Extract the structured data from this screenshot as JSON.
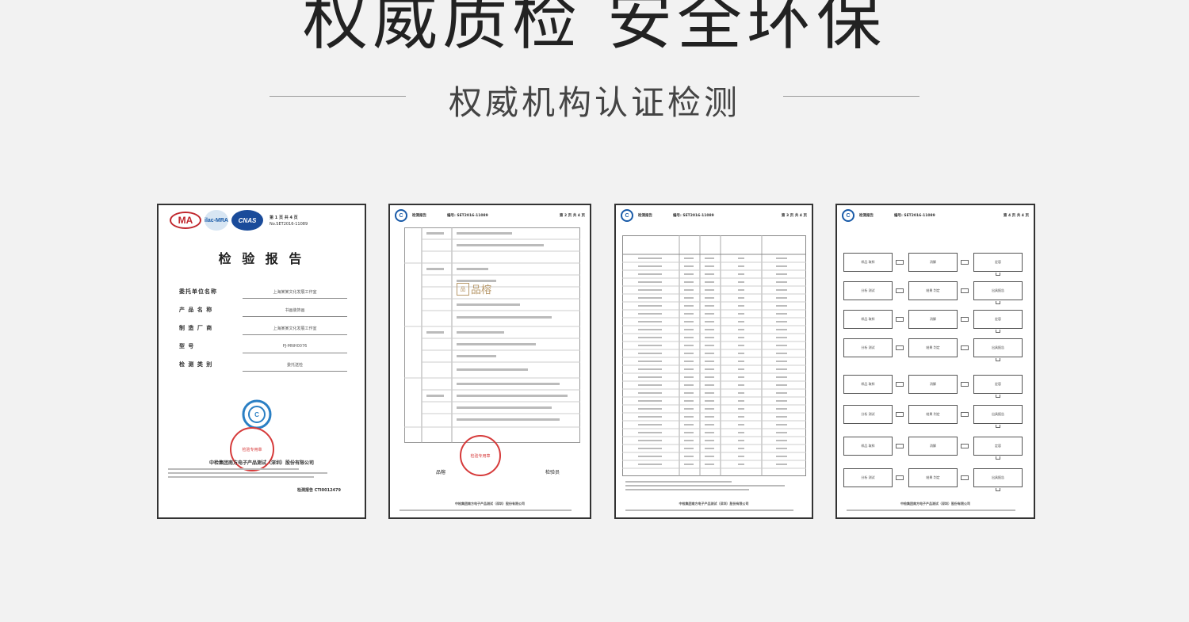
{
  "header": {
    "title": "权威质检 安全环保",
    "subtitle": "权威机构认证检测"
  },
  "doc1": {
    "logos": {
      "ma": "MA",
      "ilac": "ilac-MRA",
      "cnas": "CNAS"
    },
    "report_no": "No.SET2016-11089",
    "page_no": "第 1 页 共 4 页",
    "title": "检 验 报 告",
    "fields": [
      {
        "label": "委托单位名称",
        "value": "上海某某文化发展工作室"
      },
      {
        "label": "产 品 名 称",
        "value": "书画装饰画"
      },
      {
        "label": "制 造 厂 商",
        "value": "上海某某文化发展工作室"
      },
      {
        "label": "型 号",
        "value": "PJ-MNH0076"
      },
      {
        "label": "检 测 类 别",
        "value": "委托送检"
      }
    ],
    "seal_text": "检验专用章",
    "org": "中检集团南方电子产品测试（深圳）股份有限公司",
    "report_code": "检测报告 CTI0012479"
  },
  "doc2": {
    "header_left": "检测报告",
    "header_mid": "编号: SET2016-11089",
    "header_right": "第 2 页 共 4 页",
    "watermark_box": "品",
    "watermark_text": "品榕",
    "sig1": "品榕",
    "sig2": "检验员",
    "seal_text": "检验专用章",
    "org": "中检集团南方电子产品测试（深圳）股份有限公司"
  },
  "doc3": {
    "header_left": "检测报告",
    "header_mid": "编号: SET2016-11089",
    "header_right": "第 3 页 共 4 页",
    "org": "中检集团南方电子产品测试（深圳）股份有限公司"
  },
  "doc4": {
    "header_left": "检测报告",
    "header_mid": "编号: SET2016-11089",
    "header_right": "第 4 页 共 4 页",
    "flow": [
      "样品 取样",
      "消解",
      "定容",
      "分析 测试",
      "结果 判定",
      "出具报告"
    ],
    "org": "中检集团南方电子产品测试（深圳）股份有限公司"
  }
}
